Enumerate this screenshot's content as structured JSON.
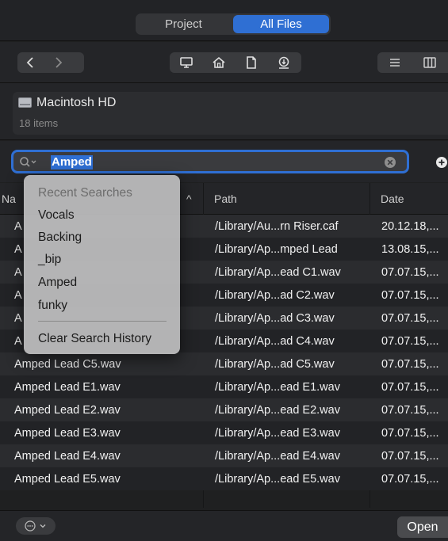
{
  "tabs": {
    "project": "Project",
    "all_files": "All Files"
  },
  "location": {
    "title": "Macintosh HD",
    "subtitle": "18 items"
  },
  "search": {
    "value": "Amped"
  },
  "columns": {
    "name": "Na",
    "path": "Path",
    "date": "Date",
    "name_sort_indicator": "^"
  },
  "rows": [
    {
      "name": "A",
      "path": "/Library/Au...rn Riser.caf",
      "date": "20.12.18,..."
    },
    {
      "name": "A",
      "path": "/Library/Ap...mped Lead",
      "date": "13.08.15,..."
    },
    {
      "name": "A",
      "path": "/Library/Ap...ead C1.wav",
      "date": "07.07.15,..."
    },
    {
      "name": "A",
      "path": "/Library/Ap...ad C2.wav",
      "date": "07.07.15,..."
    },
    {
      "name": "A",
      "path": "/Library/Ap...ad C3.wav",
      "date": "07.07.15,..."
    },
    {
      "name": "A",
      "path": "/Library/Ap...ad C4.wav",
      "date": "07.07.15,..."
    },
    {
      "name": "Amped Lead C5.wav",
      "path": "/Library/Ap...ad C5.wav",
      "date": "07.07.15,..."
    },
    {
      "name": "Amped Lead E1.wav",
      "path": "/Library/Ap...ead E1.wav",
      "date": "07.07.15,..."
    },
    {
      "name": "Amped Lead E2.wav",
      "path": "/Library/Ap...ead E2.wav",
      "date": "07.07.15,..."
    },
    {
      "name": "Amped Lead E3.wav",
      "path": "/Library/Ap...ead E3.wav",
      "date": "07.07.15,..."
    },
    {
      "name": "Amped Lead E4.wav",
      "path": "/Library/Ap...ead E4.wav",
      "date": "07.07.15,..."
    },
    {
      "name": "Amped Lead E5.wav",
      "path": "/Library/Ap...ead E5.wav",
      "date": "07.07.15,..."
    }
  ],
  "recent_menu": {
    "header": "Recent Searches",
    "items": [
      "Vocals",
      "Backing",
      "_bip",
      "Amped",
      "funky"
    ],
    "clear": "Clear Search History"
  },
  "footer": {
    "open": "Open"
  },
  "colors": {
    "accent": "#2f6fd3",
    "background": "#1f2021"
  },
  "icons": [
    "chevron-left-icon",
    "chevron-right-icon",
    "computer-icon",
    "home-icon",
    "document-icon",
    "downloads-icon",
    "list-view-icon",
    "column-view-icon",
    "search-icon",
    "clear-icon",
    "add-icon",
    "hard-drive-icon",
    "ellipsis-icon"
  ]
}
